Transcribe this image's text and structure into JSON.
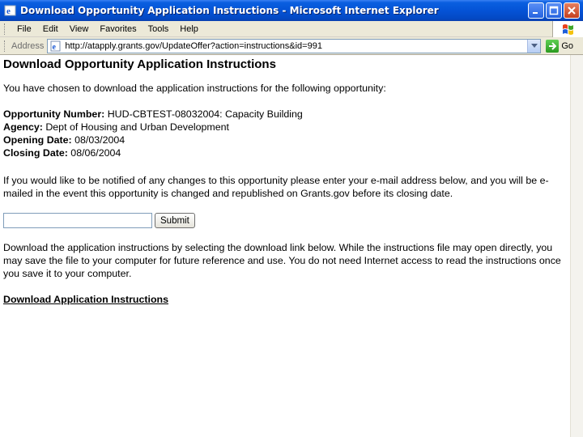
{
  "window": {
    "title": "Download Opportunity Application Instructions - Microsoft Internet Explorer"
  },
  "menu": {
    "items": [
      "File",
      "Edit",
      "View",
      "Favorites",
      "Tools",
      "Help"
    ]
  },
  "address_bar": {
    "label": "Address",
    "url": "http://atapply.grants.gov/UpdateOffer?action=instructions&id=991",
    "go_label": "Go"
  },
  "page": {
    "heading": "Download Opportunity Application Instructions",
    "intro": "You have chosen to download the application instructions for the following opportunity:",
    "details": [
      {
        "label": "Opportunity Number:",
        "value": " HUD-CBTEST-08032004: Capacity Building"
      },
      {
        "label": "Agency:",
        "value": " Dept of Housing and Urban Development"
      },
      {
        "label": "Opening Date:",
        "value": " 08/03/2004"
      },
      {
        "label": "Closing Date:",
        "value": " 08/06/2004"
      }
    ],
    "notify_text": "If you would like to be notified of any changes to this opportunity please enter your e-mail address below, and you will be e-mailed in the event this opportunity is changed and republished on Grants.gov before its closing date.",
    "email_value": "",
    "submit_label": "Submit",
    "download_text": "Download the application instructions by selecting the download link below. While the instructions file may open directly, you may save the file to your computer for future reference and use. You do not need Internet access to read the instructions once you save it to your computer.",
    "download_link": "Download Application Instructions"
  }
}
